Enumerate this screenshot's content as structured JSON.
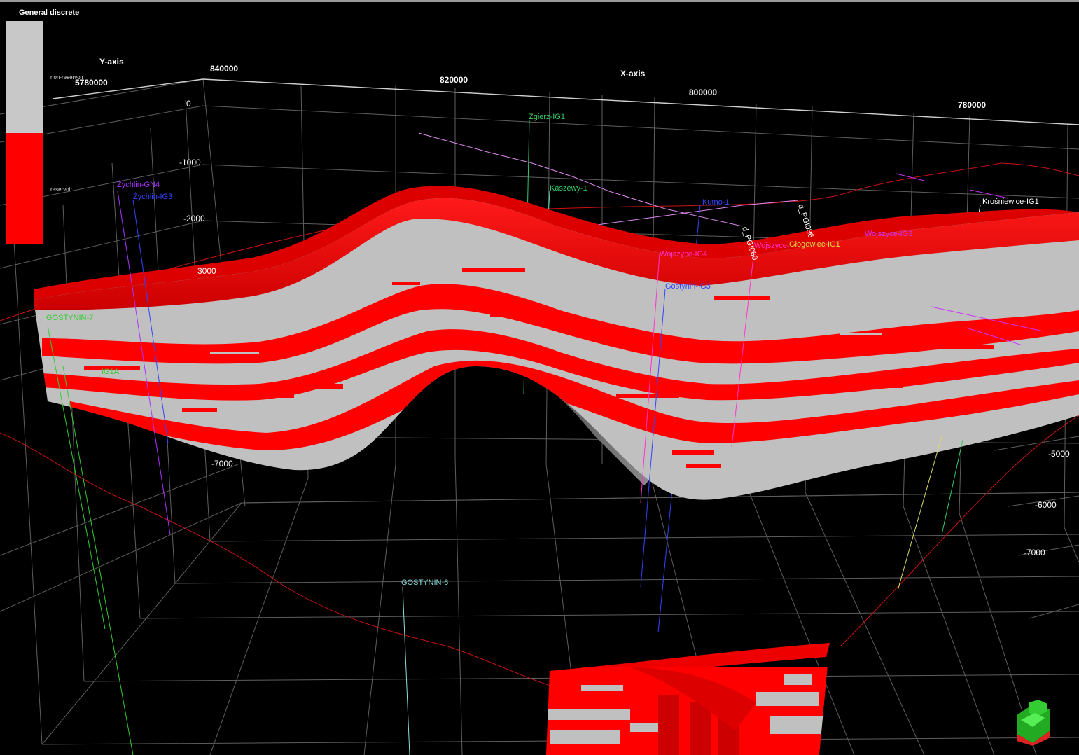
{
  "legend": {
    "title": "General discrete",
    "items": [
      {
        "label": "non-reservoir",
        "color": "#c8c8c8"
      },
      {
        "label": "reservoir",
        "color": "#ff0000"
      }
    ]
  },
  "axes": {
    "y_axis_title": "Y-axis",
    "x_axis_title": "X-axis",
    "y_ticks": [
      "5780000"
    ],
    "x_ticks": [
      "840000",
      "820000",
      "800000",
      "780000"
    ],
    "z_ticks_left": [
      "0",
      "-1000",
      "-2000",
      "3000",
      "-7000"
    ],
    "z_ticks_right": [
      "-5000",
      "-6000",
      "-7000"
    ]
  },
  "wells": [
    {
      "name": "Zgierz-IG1",
      "color": "#33cc66"
    },
    {
      "name": "Kaszewy-1",
      "color": "#33cc66"
    },
    {
      "name": "Kutno-1",
      "color": "#3344ff"
    },
    {
      "name": "d_PGI036",
      "color": "#ffffff"
    },
    {
      "name": "d_PGI060",
      "color": "#ffffff"
    },
    {
      "name": "Wojszyce-",
      "color": "#ff33cc"
    },
    {
      "name": "Głogowiec-IG1",
      "color": "#dddd44"
    },
    {
      "name": "Wojszyce-IG3",
      "color": "#cc33ff"
    },
    {
      "name": "Krośniewice-IG1",
      "color": "#ffffff"
    },
    {
      "name": "Żychlin-GN4",
      "color": "#aa33ff"
    },
    {
      "name": "Żychlin-IG3",
      "color": "#3344ff"
    },
    {
      "name": "Gostynin-IG3",
      "color": "#3344ff"
    },
    {
      "name": "GOSTYNIN-7",
      "color": "#33cc33"
    },
    {
      "name": "IG1A",
      "color": "#33cc33"
    },
    {
      "name": "GOSTYNIN-6",
      "color": "#88dddd"
    },
    {
      "name": "Wojszyce-IG4",
      "color": "#ff33cc"
    }
  ],
  "colors": {
    "reservoir": "#ff0000",
    "non_reservoir": "#c0c0c0",
    "grid": "#6a6a6a",
    "background": "#000000"
  }
}
